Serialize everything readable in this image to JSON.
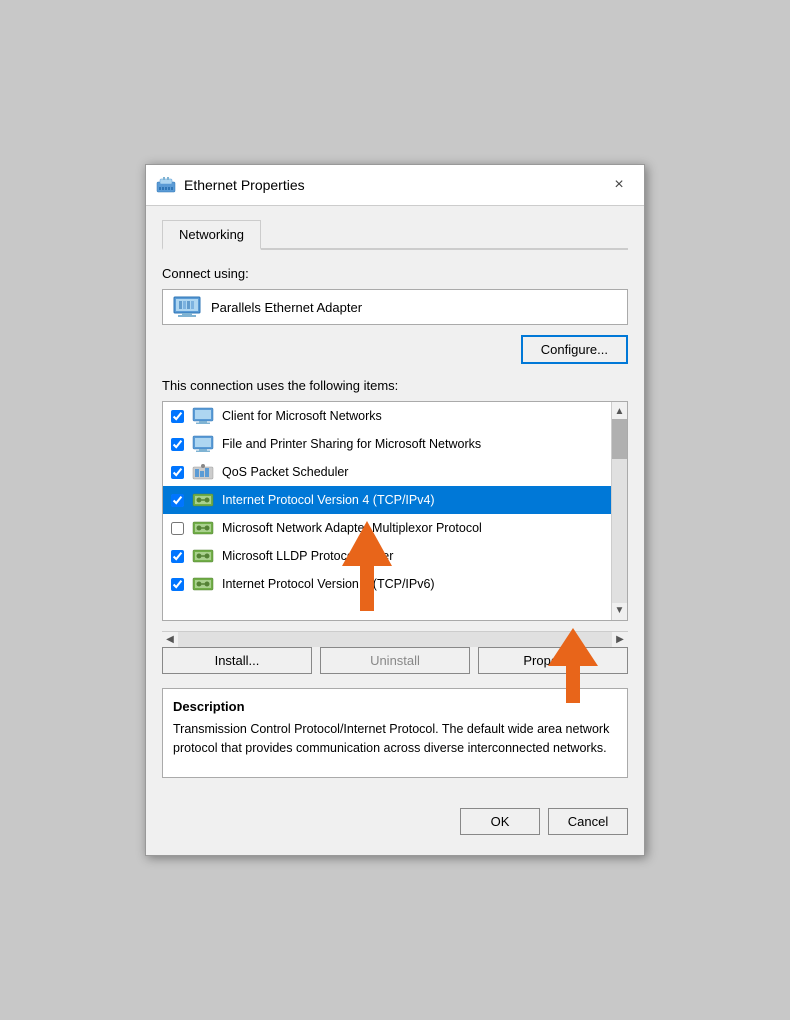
{
  "titleBar": {
    "title": "Ethernet Properties",
    "closeLabel": "×"
  },
  "tabs": [
    {
      "label": "Networking",
      "active": true
    }
  ],
  "connectUsing": {
    "label": "Connect using:",
    "adapterName": "Parallels Ethernet Adapter"
  },
  "configureButton": "Configure...",
  "connectionItemsLabel": "This connection uses the following items:",
  "items": [
    {
      "id": 0,
      "checked": true,
      "selected": false,
      "text": "Client for Microsoft Networks",
      "iconType": "network"
    },
    {
      "id": 1,
      "checked": true,
      "selected": false,
      "text": "File and Printer Sharing for Microsoft Networks",
      "iconType": "network"
    },
    {
      "id": 2,
      "checked": true,
      "selected": false,
      "text": "QoS Packet Scheduler",
      "iconType": "qos"
    },
    {
      "id": 3,
      "checked": true,
      "selected": true,
      "text": "Internet Protocol Version 4 (TCP/IPv4)",
      "iconType": "protocol"
    },
    {
      "id": 4,
      "checked": false,
      "selected": false,
      "text": "Microsoft Network Adapter Multiplexor Protocol",
      "iconType": "protocol"
    },
    {
      "id": 5,
      "checked": true,
      "selected": false,
      "text": "Microsoft LLDP Protocol Driver",
      "iconType": "protocol"
    },
    {
      "id": 6,
      "checked": true,
      "selected": false,
      "text": "Internet Protocol Version 6 (TCP/IPv6)",
      "iconType": "protocol"
    }
  ],
  "buttons": {
    "install": "Install...",
    "uninstall": "Uninstall",
    "properties": "Properties"
  },
  "description": {
    "title": "Description",
    "text": "Transmission Control Protocol/Internet Protocol. The default wide area network protocol that provides communication across diverse interconnected networks."
  },
  "footer": {
    "ok": "OK",
    "cancel": "Cancel"
  }
}
